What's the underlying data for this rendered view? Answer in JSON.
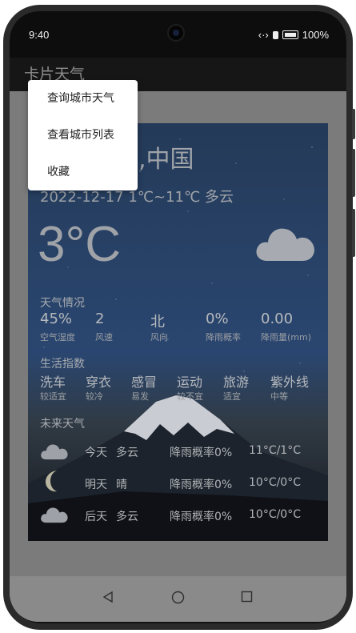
{
  "status_bar": {
    "time": "9:40",
    "battery": "100%"
  },
  "app_bar": {
    "title": "卡片天气"
  },
  "menu": {
    "items": [
      {
        "label": "查询城市天气"
      },
      {
        "label": "查看城市列表"
      },
      {
        "label": "收藏"
      }
    ]
  },
  "weather": {
    "city": "川,中国",
    "date_line": "2022-12-17  1℃~11℃  多云",
    "temperature": "3°C",
    "condition_icon": "cloud-icon",
    "details_title": "天气情况",
    "details": [
      {
        "value": "45%",
        "label": "空气湿度"
      },
      {
        "value": "2",
        "label": "风速"
      },
      {
        "value": "北",
        "label": "风向"
      },
      {
        "value": "0%",
        "label": "降雨概率"
      },
      {
        "value": "0.00",
        "label": "降雨量(mm)"
      }
    ],
    "life_title": "生活指数",
    "life_indices": [
      {
        "value": "洗车",
        "label": "较适宜"
      },
      {
        "value": "穿衣",
        "label": "较冷"
      },
      {
        "value": "感冒",
        "label": "易发"
      },
      {
        "value": "运动",
        "label": "较不宜"
      },
      {
        "value": "旅游",
        "label": "适宜"
      },
      {
        "value": "紫外线",
        "label": "中等"
      }
    ],
    "forecast_title": "未来天气",
    "forecast": [
      {
        "icon": "cloud-icon",
        "day": "今天",
        "condition": "多云",
        "rain": "降雨概率0%",
        "range": "11°C/1°C"
      },
      {
        "icon": "moon-icon",
        "day": "明天",
        "condition": "晴",
        "rain": "降雨概率0%",
        "range": "10°C/0°C"
      },
      {
        "icon": "cloud-icon",
        "day": "后天",
        "condition": "多云",
        "rain": "降雨概率0%",
        "range": "10°C/0°C"
      }
    ]
  },
  "nav_bar": {
    "back_icon": "triangle-back-icon",
    "home_icon": "circle-home-icon",
    "recents_icon": "square-recents-icon"
  },
  "colors": {
    "overlay": "#7b7b7b",
    "status_bar": "#0d0d0d",
    "app_bar": "#161616",
    "menu": "#ffffff"
  }
}
